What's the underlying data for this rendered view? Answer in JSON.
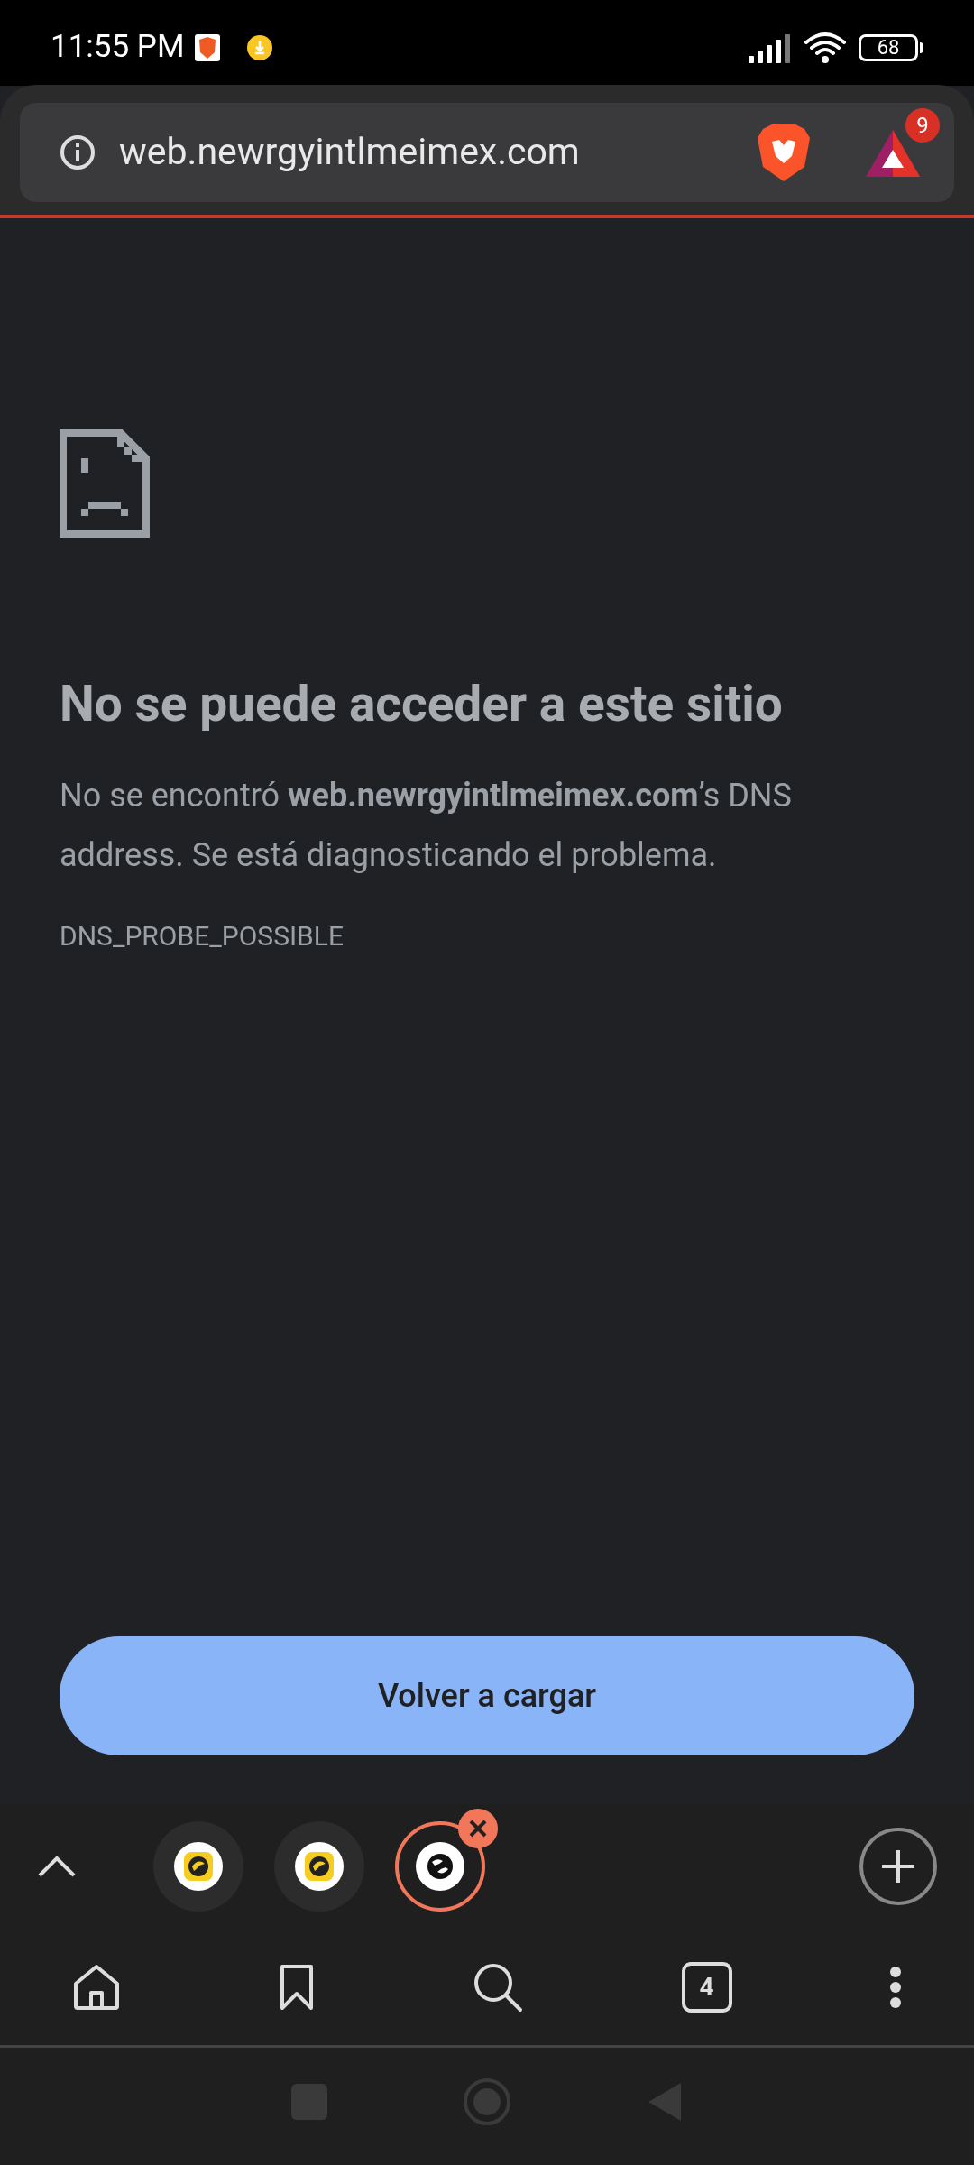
{
  "status_bar": {
    "time": "11:55 PM",
    "battery": "68"
  },
  "address_bar": {
    "url": "web.newrgyintlmeimex.com",
    "rewards_badge": "9"
  },
  "error": {
    "title": "No se puede acceder a este sitio",
    "message": "No se encontró **web.newrgyintlmeimex.com**’s DNS address. Se está diagnosticando el problema.",
    "code": "DNS_PROBE_POSSIBLE"
  },
  "reload_button": "Volver a cargar",
  "tab_strip": {
    "tabs": [
      {
        "kind": "app",
        "selected": false
      },
      {
        "kind": "app",
        "selected": false
      },
      {
        "kind": "web",
        "selected": true
      }
    ]
  },
  "toolbar": {
    "tab_count": "4"
  }
}
